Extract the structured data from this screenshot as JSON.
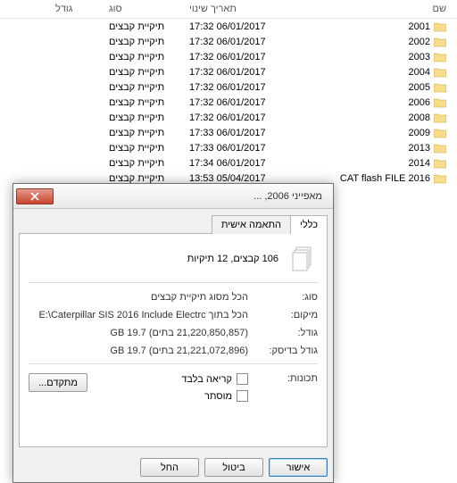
{
  "columns": {
    "name": "שם",
    "date": "תאריך שינוי",
    "type": "סוג",
    "size": "גודל"
  },
  "files": [
    {
      "name": "2001",
      "date": "06/01/2017 17:32",
      "type": "תיקיית קבצים"
    },
    {
      "name": "2002",
      "date": "06/01/2017 17:32",
      "type": "תיקיית קבצים"
    },
    {
      "name": "2003",
      "date": "06/01/2017 17:32",
      "type": "תיקיית קבצים"
    },
    {
      "name": "2004",
      "date": "06/01/2017 17:32",
      "type": "תיקיית קבצים"
    },
    {
      "name": "2005",
      "date": "06/01/2017 17:32",
      "type": "תיקיית קבצים"
    },
    {
      "name": "2006",
      "date": "06/01/2017 17:32",
      "type": "תיקיית קבצים"
    },
    {
      "name": "2008",
      "date": "06/01/2017 17:32",
      "type": "תיקיית קבצים"
    },
    {
      "name": "2009",
      "date": "06/01/2017 17:33",
      "type": "תיקיית קבצים"
    },
    {
      "name": "2013",
      "date": "06/01/2017 17:33",
      "type": "תיקיית קבצים"
    },
    {
      "name": "2014",
      "date": "06/01/2017 17:34",
      "type": "תיקיית קבצים"
    },
    {
      "name": "2016 CAT flash FILE",
      "date": "05/04/2017 13:53",
      "type": "תיקיית קבצים"
    }
  ],
  "dialog": {
    "title": "מאפייני 2006, ...",
    "tabs": {
      "general": "כללי",
      "custom": "התאמה אישית"
    },
    "summary": "106 קבצים, 12 תיקיות",
    "type_label": "סוג:",
    "type_value": "הכל מסוג תיקיית קבצים",
    "location_label": "מיקום:",
    "location_value": "הכל בתוך E:\\Caterpillar SIS 2016 Include Electrc",
    "size_label": "גודל:",
    "size_value": "(21,220,850,857 בתים) 19.7 GB",
    "disk_label": "גודל בדיסק:",
    "disk_value": "(21,221,072,896 בתים) 19.7 GB",
    "attr_label": "תכונות:",
    "readonly": "קריאה בלבד",
    "hidden": "מוסתר",
    "advanced": "מתקדם...",
    "ok": "אישור",
    "cancel": "ביטול",
    "apply": "החל"
  }
}
